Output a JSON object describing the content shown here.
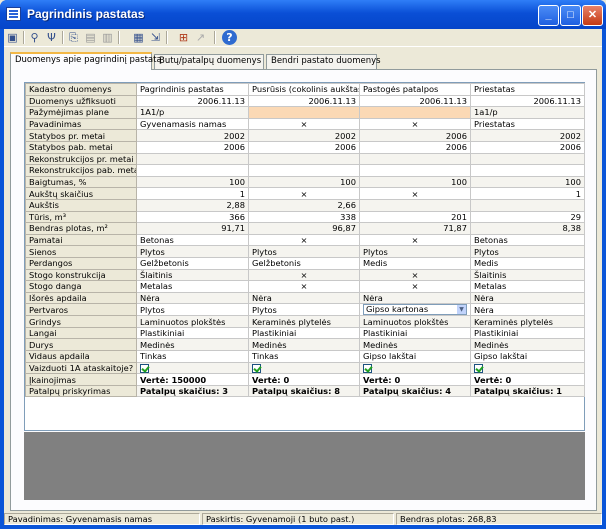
{
  "window": {
    "title": "Pagrindinis pastatas",
    "minimize": "_",
    "maximize": "□",
    "close": "✕"
  },
  "toolbar": {
    "icons": [
      "save-icon",
      "tree-icon",
      "structure-icon",
      "copy-icon",
      "paste-icon",
      "print-icon",
      "calculator-icon",
      "export-icon",
      "tools-icon",
      "help-icon"
    ]
  },
  "tabs": [
    "Duomenys apie pagrindinį pastatą",
    "Butų/patalpų duomenys",
    "Bendri pastato duomenys"
  ],
  "grid": {
    "header": [
      "Kadastro duomenys",
      "Pagrindinis pastatas",
      "Pusrūsis (cokolinis aukštas",
      "Pastogės patalpos",
      "Priestatas"
    ],
    "rows": [
      {
        "label": "Duomenys užfiksuoti",
        "cells": [
          "2006.11.13",
          "2006.11.13",
          "2006.11.13",
          "2006.11.13"
        ]
      },
      {
        "label": "Pažymėjimas plane",
        "cells": [
          "1A1/p",
          "",
          "",
          "1a1/p"
        ]
      },
      {
        "label": "Pavadinimas",
        "cells": [
          "Gyvenamasis namas",
          "×",
          "×",
          "Priestatas"
        ]
      },
      {
        "label": "Statybos pr. metai",
        "cells": [
          "2002",
          "2002",
          "2006",
          "2002"
        ]
      },
      {
        "label": "Statybos pab. metai",
        "cells": [
          "2006",
          "2006",
          "2006",
          "2006"
        ]
      },
      {
        "label": "Rekonstrukcijos pr. metai",
        "cells": [
          "",
          "",
          "",
          ""
        ]
      },
      {
        "label": "Rekonstrukcijos pab. meta",
        "cells": [
          "",
          "",
          "",
          ""
        ]
      },
      {
        "label": "Baigtumas, %",
        "cells": [
          "100",
          "100",
          "100",
          "100"
        ]
      },
      {
        "label": "Aukštų skaičius",
        "cells": [
          "1",
          "×",
          "×",
          "1"
        ]
      },
      {
        "label": "Aukštis",
        "cells": [
          "2,88",
          "2,66",
          "",
          ""
        ]
      },
      {
        "label": "Tūris, m³",
        "cells": [
          "366",
          "338",
          "201",
          "29"
        ]
      },
      {
        "label": "Bendras plotas, m²",
        "cells": [
          "91,71",
          "96,87",
          "71,87",
          "8,38"
        ]
      },
      {
        "label": "Pamatai",
        "cells": [
          "Betonas",
          "×",
          "×",
          "Betonas"
        ]
      },
      {
        "label": "Sienos",
        "cells": [
          "Plytos",
          "Plytos",
          "Plytos",
          "Plytos"
        ]
      },
      {
        "label": "Perdangos",
        "cells": [
          "Gelžbetonis",
          "Gelžbetonis",
          "Medis",
          "Medis"
        ]
      },
      {
        "label": "Stogo konstrukcija",
        "cells": [
          "Šlaitinis",
          "×",
          "×",
          "Šlaitinis"
        ]
      },
      {
        "label": "Stogo danga",
        "cells": [
          "Metalas",
          "×",
          "×",
          "Metalas"
        ]
      },
      {
        "label": "Išorės apdaila",
        "cells": [
          "Nėra",
          "Nėra",
          "Nėra",
          "Nėra"
        ]
      },
      {
        "label": "Pertvaros",
        "cells": [
          "Plytos",
          "Plytos",
          "Gipso kartonas",
          "Nėra"
        ]
      },
      {
        "label": "Grindys",
        "cells": [
          "Laminuotos plokštės",
          "Keraminės plytelės",
          "Laminuotos plokštės",
          "Keraminės plytelės"
        ]
      },
      {
        "label": "Langai",
        "cells": [
          "Plastikiniai",
          "Plastikiniai",
          "Plastikiniai",
          "Plastikiniai"
        ]
      },
      {
        "label": "Durys",
        "cells": [
          "Medinės",
          "Medinės",
          "Medinės",
          "Medinės"
        ]
      },
      {
        "label": "Vidaus apdaila",
        "cells": [
          "Tinkas",
          "Tinkas",
          "Gipso lakštai",
          "Gipso lakštai"
        ]
      },
      {
        "label": "Vaizduoti 1A ataskaitoje?",
        "cells": [
          "",
          "",
          "",
          ""
        ]
      },
      {
        "label": "Įkainojimas",
        "cells": [
          "Vertė: 150000",
          "Vertė: 0",
          "Vertė: 0",
          "Vertė: 0"
        ]
      },
      {
        "label": "Patalpų priskyrimas",
        "cells": [
          "Patalpų skaičius: 3",
          "Patalpų skaičius: 8",
          "Patalpų skaičius: 4",
          "Patalpų skaičius: 1"
        ]
      }
    ]
  },
  "status": [
    "Pavadinimas: Gyvenamasis namas",
    "Paskirtis: Gyvenamoji (1 buto past.)",
    "Bendras plotas: 268,83"
  ]
}
